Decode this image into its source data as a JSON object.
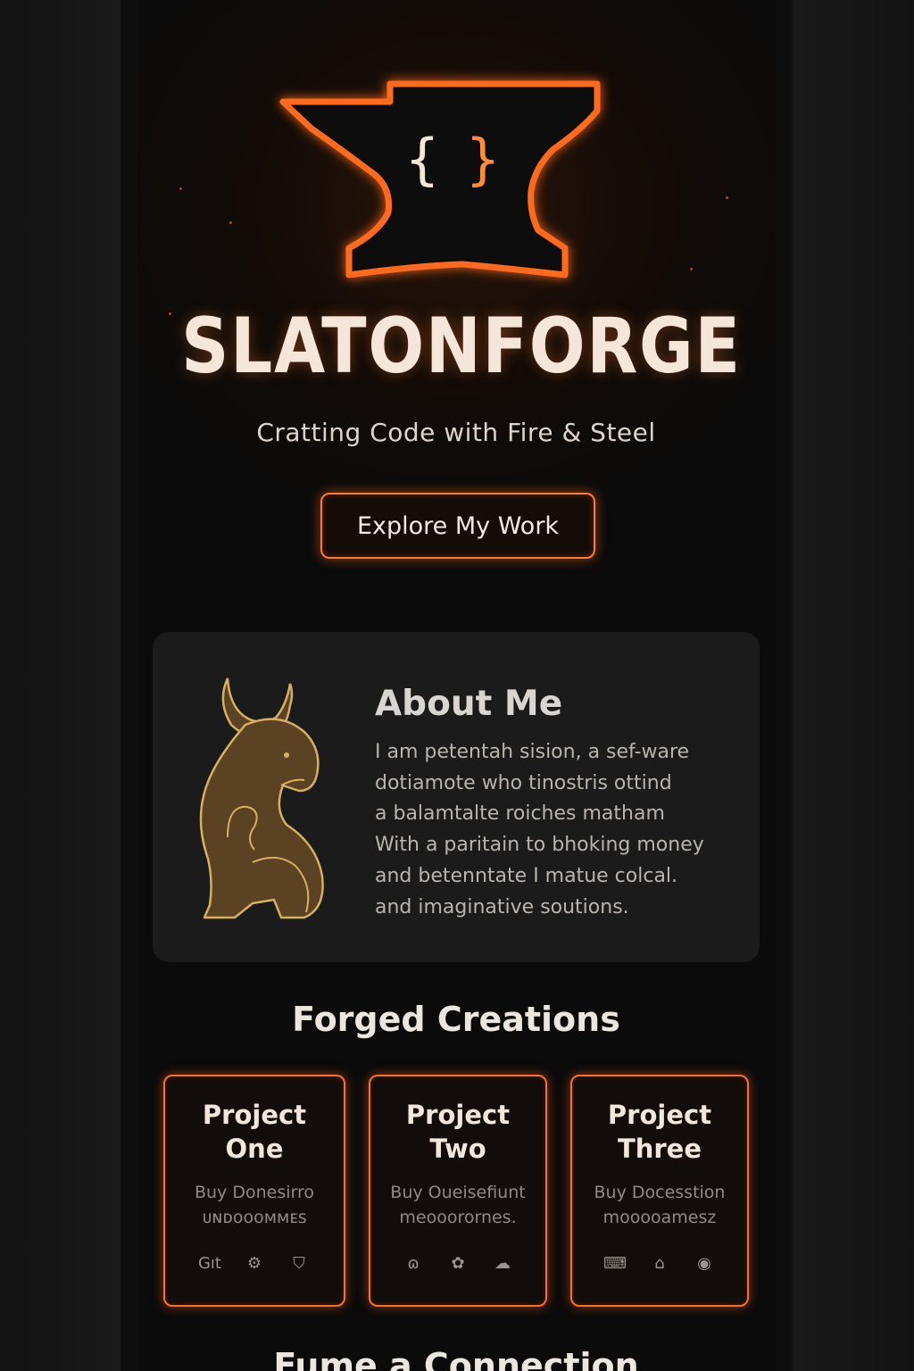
{
  "brand": {
    "name": "SLATONFORGE",
    "logo_glyph": "{ }",
    "tagline": "Cratting Code with Fire & Steel"
  },
  "hero": {
    "cta_label": "Explore My Work"
  },
  "about": {
    "title": "About Me",
    "lines": [
      "I am petentah sision, a sef-ware",
      "dotiamote who tinostris ottind",
      "a balamtalte roiches matham",
      "With a paritain to bhoking money",
      "and betenntate I matue colcal.",
      "and imaginative soutions."
    ]
  },
  "projects": {
    "title": "Forged Creations",
    "items": [
      {
        "title_line1": "Project",
        "title_line2": "One",
        "desc_line1": "Buy Donesirro",
        "desc_line2": "ᴜɴᴅᴏᴏᴏᴍᴍᴇs",
        "icons": [
          "git-icon",
          "gear-icon",
          "shield-icon"
        ],
        "icon_labels": [
          "Gıt",
          "⚙",
          "⛉"
        ]
      },
      {
        "title_line1": "Project",
        "title_line2": "Two",
        "desc_line1": "Buy Oueisefiunt",
        "desc_line2": "meooorornes.",
        "icons": [
          "bug-icon",
          "puzzle-icon",
          "cloud-icon"
        ],
        "icon_labels": [
          "ɷ",
          "✿",
          "☁"
        ]
      },
      {
        "title_line1": "Project",
        "title_line2": "Three",
        "desc_line1": "Buy Docesstion",
        "desc_line2": "mooooamesz",
        "icons": [
          "keyboard-icon",
          "home-icon",
          "eye-icon"
        ],
        "icon_labels": [
          "⌨",
          "⌂",
          "◉"
        ]
      }
    ]
  },
  "footer": {
    "title": "Fume a Connection"
  },
  "colors": {
    "accent": "#ff7a2a",
    "background": "#0b0b0b",
    "card": "#1b1b1b",
    "figure_gold": "#c9a35a"
  }
}
